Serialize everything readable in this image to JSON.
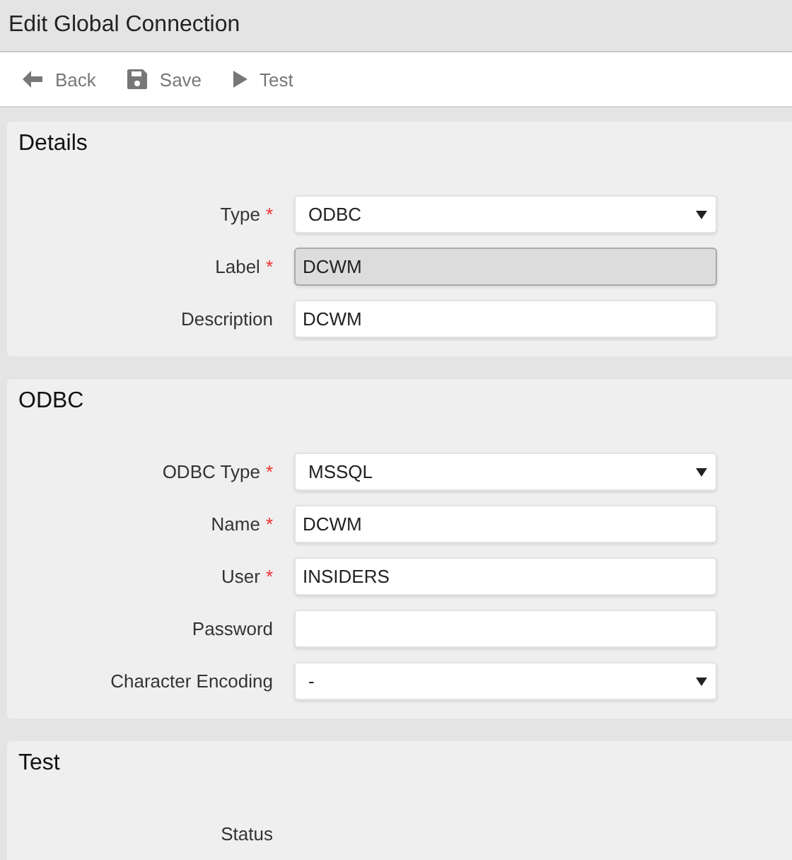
{
  "window": {
    "title": "Edit Global Connection"
  },
  "toolbar": [
    {
      "label": "Back",
      "kind": "back"
    },
    {
      "label": "Save",
      "kind": "save"
    },
    {
      "label": "Test",
      "kind": "test"
    }
  ],
  "sections": [
    {
      "title": "Details",
      "fields": [
        {
          "label": "Type",
          "required_mark": "*",
          "kind": "select",
          "value": "ODBC"
        },
        {
          "label": "Label",
          "required_mark": "*",
          "kind": "text",
          "disabled": true,
          "value": "DCWM"
        },
        {
          "label": "Description",
          "kind": "text",
          "disabled": false,
          "value": "DCWM"
        }
      ]
    },
    {
      "title": "ODBC",
      "fields": [
        {
          "label": "ODBC Type",
          "required_mark": "*",
          "kind": "select",
          "value": "MSSQL"
        },
        {
          "label": "Name",
          "required_mark": "*",
          "kind": "text",
          "disabled": false,
          "value": "DCWM"
        },
        {
          "label": "User",
          "required_mark": "*",
          "kind": "text",
          "disabled": false,
          "value": "INSIDERS"
        },
        {
          "label": "Password",
          "kind": "password",
          "disabled": false
        },
        {
          "label": "Character Encoding",
          "kind": "select",
          "value": "-"
        }
      ]
    },
    {
      "title": "Test",
      "fields": [
        {
          "label": "Status",
          "kind": "display"
        }
      ]
    }
  ]
}
